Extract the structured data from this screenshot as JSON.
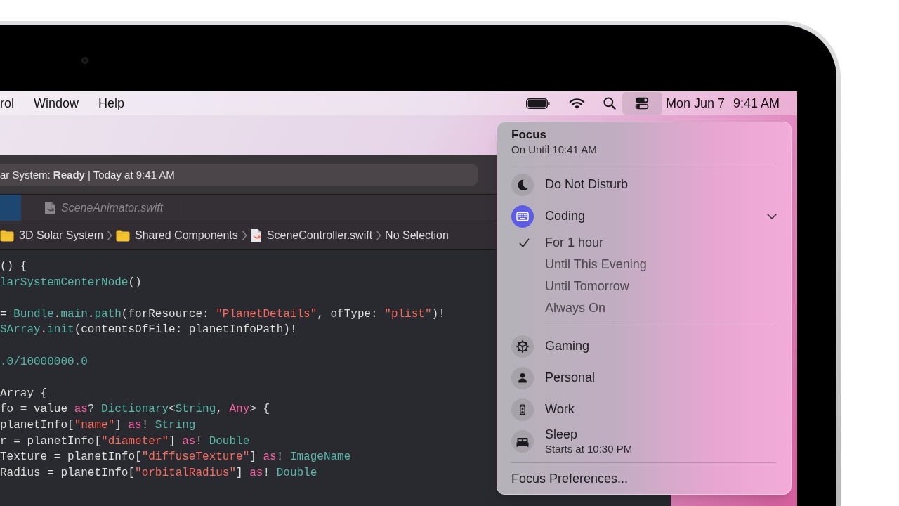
{
  "menu_bar": {
    "menus": [
      "rol",
      "Window",
      "Help"
    ],
    "status_items": [
      {
        "kind": "battery",
        "selected": false
      },
      {
        "kind": "wifi",
        "selected": false
      },
      {
        "kind": "search",
        "selected": false
      },
      {
        "kind": "control_center",
        "selected": true
      }
    ],
    "date": "Mon Jun 7",
    "time": "9:41 AM"
  },
  "editor_window": {
    "activity": "ar System: **Ready** | Today at 9:41 AM",
    "tabs": [
      {
        "selected": true
      },
      {
        "label": "SceneAnimator.swift",
        "selected": false
      }
    ],
    "jump_bar": [
      {
        "kind": "folder",
        "label": "3D Solar System"
      },
      {
        "kind": "folder",
        "label": "Shared Components"
      },
      {
        "kind": "swift_file",
        "label": "SceneController.swift"
      },
      {
        "kind": "plain",
        "label": "No Selection"
      }
    ],
    "code_blocks": [
      [
        [
          {
            "kind": "plain",
            "text": "() {"
          }
        ],
        [
          {
            "kind": "type",
            "text": "larSystemCenterNode"
          },
          {
            "kind": "plain",
            "text": "()"
          }
        ]
      ],
      [
        [
          {
            "kind": "plain",
            "text": "= "
          },
          {
            "kind": "type",
            "text": "Bundle"
          },
          {
            "kind": "plain",
            "text": "."
          },
          {
            "kind": "type",
            "text": "main"
          },
          {
            "kind": "plain",
            "text": "."
          },
          {
            "kind": "type",
            "text": "path"
          },
          {
            "kind": "plain",
            "text": "(forResource: "
          },
          {
            "kind": "string",
            "text": "\"PlanetDetails\""
          },
          {
            "kind": "plain",
            "text": ", ofType: "
          },
          {
            "kind": "string",
            "text": "\"plist\""
          },
          {
            "kind": "plain",
            "text": ")!"
          }
        ],
        [
          {
            "kind": "type",
            "text": "SArray"
          },
          {
            "kind": "plain",
            "text": "."
          },
          {
            "kind": "type",
            "text": "init"
          },
          {
            "kind": "plain",
            "text": "(contentsOfFile: planetInfoPath)!"
          }
        ]
      ],
      [
        [
          {
            "kind": "type",
            "text": ".0/10000000.0"
          }
        ]
      ],
      [
        [
          {
            "kind": "plain",
            "text": "Array {"
          }
        ],
        [
          {
            "kind": "plain",
            "text": "fo = value "
          },
          {
            "kind": "keyword",
            "text": "as"
          },
          {
            "kind": "plain",
            "text": "? "
          },
          {
            "kind": "type",
            "text": "Dictionary"
          },
          {
            "kind": "plain",
            "text": "<"
          },
          {
            "kind": "type",
            "text": "String"
          },
          {
            "kind": "plain",
            "text": ", "
          },
          {
            "kind": "keyword",
            "text": "Any"
          },
          {
            "kind": "plain",
            "text": "> {"
          }
        ],
        [
          {
            "kind": "plain",
            "text": "planetInfo["
          },
          {
            "kind": "string",
            "text": "\"name\""
          },
          {
            "kind": "plain",
            "text": "] "
          },
          {
            "kind": "keyword",
            "text": "as"
          },
          {
            "kind": "plain",
            "text": "! "
          },
          {
            "kind": "type",
            "text": "String"
          }
        ],
        [
          {
            "kind": "plain",
            "text": "r = planetInfo["
          },
          {
            "kind": "string",
            "text": "\"diameter\""
          },
          {
            "kind": "plain",
            "text": "] "
          },
          {
            "kind": "keyword",
            "text": "as"
          },
          {
            "kind": "plain",
            "text": "! "
          },
          {
            "kind": "type",
            "text": "Double"
          }
        ],
        [
          {
            "kind": "plain",
            "text": "Texture = planetInfo["
          },
          {
            "kind": "string",
            "text": "\"diffuseTexture\""
          },
          {
            "kind": "plain",
            "text": "] "
          },
          {
            "kind": "keyword",
            "text": "as"
          },
          {
            "kind": "plain",
            "text": "! "
          },
          {
            "kind": "type",
            "text": "ImageName"
          }
        ],
        [
          {
            "kind": "plain",
            "text": "Radius = planetInfo["
          },
          {
            "kind": "string",
            "text": "\"orbitalRadius\""
          },
          {
            "kind": "plain",
            "text": "] "
          },
          {
            "kind": "keyword",
            "text": "as"
          },
          {
            "kind": "plain",
            "text": "! "
          },
          {
            "kind": "type",
            "text": "Double"
          }
        ]
      ]
    ]
  },
  "focus_menu": {
    "title": "Focus",
    "subtitle": "On Until 10:41 AM",
    "modes": [
      {
        "label": "Do Not Disturb",
        "kind": "moon",
        "on": false,
        "expanded": false
      },
      {
        "label": "Coding",
        "kind": "keyboard",
        "on": true,
        "expanded": true,
        "options": [
          {
            "label": "For 1 hour",
            "selected": true
          },
          {
            "label": "Until This Evening",
            "selected": false
          },
          {
            "label": "Until Tomorrow",
            "selected": false
          },
          {
            "label": "Always On",
            "selected": false
          }
        ]
      },
      {
        "label": "Gaming",
        "kind": "gear",
        "on": false,
        "expanded": false
      },
      {
        "label": "Personal",
        "kind": "person",
        "on": false,
        "expanded": false
      },
      {
        "label": "Work",
        "kind": "badge",
        "on": false,
        "expanded": false
      },
      {
        "label": "Sleep",
        "kind": "bed",
        "on": false,
        "expanded": false,
        "detail": "Starts at 10:30 PM"
      }
    ],
    "preferences": "Focus Preferences..."
  }
}
